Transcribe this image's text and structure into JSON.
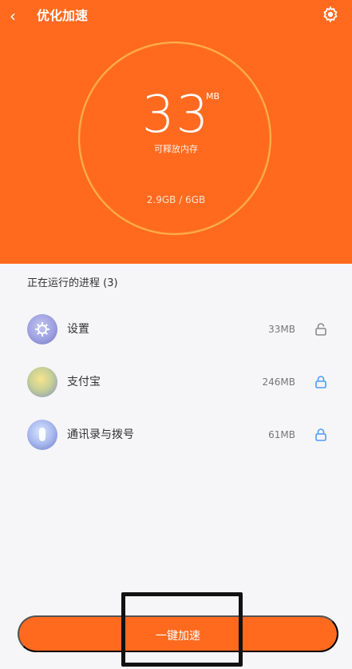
{
  "header": {
    "title": "优化加速",
    "back_icon": "chevron-left-icon",
    "settings_icon": "gear-icon"
  },
  "memory": {
    "value": "33",
    "unit": "MB",
    "label": "可释放内存",
    "usage": "2.9GB / 6GB"
  },
  "processes": {
    "title": "正在运行的进程 (3)",
    "items": [
      {
        "name": "设置",
        "size": "33MB",
        "icon": "settings-app-icon",
        "locked": false
      },
      {
        "name": "支付宝",
        "size": "246MB",
        "icon": "alipay-app-icon",
        "locked": true
      },
      {
        "name": "通讯录与拨号",
        "size": "61MB",
        "icon": "contacts-dialer-app-icon",
        "locked": true
      }
    ]
  },
  "actions": {
    "boost_label": "一键加速"
  },
  "colors": {
    "accent": "#ff6a1f",
    "lock_active": "#4a9cff",
    "lock_inactive": "#8a8a8a"
  }
}
